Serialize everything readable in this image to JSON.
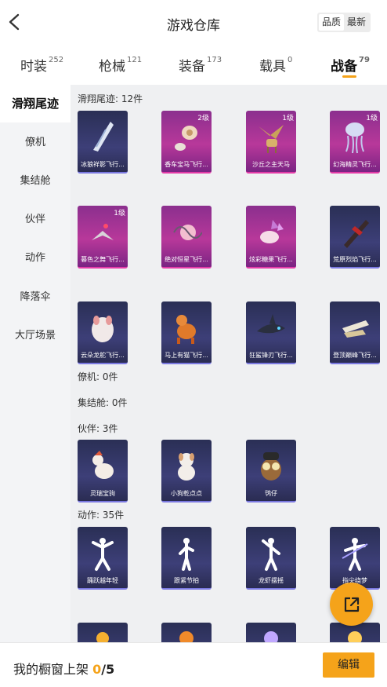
{
  "header": {
    "title": "游戏仓库",
    "sort_options": [
      "品质",
      "最新"
    ],
    "sort_selected": "品质"
  },
  "tabs": [
    {
      "label": "时装",
      "count": "252"
    },
    {
      "label": "枪械",
      "count": "121"
    },
    {
      "label": "装备",
      "count": "173"
    },
    {
      "label": "载具",
      "count": "0"
    },
    {
      "label": "战备",
      "count": "79",
      "active": true
    }
  ],
  "colors": {
    "accent": "#f5a31a",
    "rare_card": "#b8389a",
    "epic_card": "#3d3f78"
  },
  "sidebar": {
    "items": [
      "滑翔尾迹",
      "僚机",
      "集结舱",
      "伙伴",
      "动作",
      "降落伞",
      "大厅场景"
    ],
    "active": "滑翔尾迹"
  },
  "sections": {
    "glide_title": "滑翔尾迹: 12件",
    "glide_items": [
      {
        "name": "冰狼祥影飞行...",
        "level": "",
        "icon": "ice-wing-icon"
      },
      {
        "name": "香车宝马飞行...",
        "level": "2级",
        "icon": "carriage-icon"
      },
      {
        "name": "沙丘之主天马",
        "level": "1级",
        "icon": "pegasus-icon"
      },
      {
        "name": "幻海精灵飞行...",
        "level": "1级",
        "icon": "jellyfish-icon"
      },
      {
        "name": "暮色之舞飞行...",
        "level": "1级",
        "icon": "dusk-dance-icon"
      },
      {
        "name": "绝对恒星飞行...",
        "level": "",
        "icon": "star-orb-icon"
      },
      {
        "name": "炫彩糖果飞行...",
        "level": "",
        "icon": "candy-icon"
      },
      {
        "name": "荒原烈焰飞行...",
        "level": "",
        "icon": "flame-craft-icon"
      },
      {
        "name": "云朵龙舵飞行...",
        "level": "",
        "icon": "cloud-dragon-icon"
      },
      {
        "name": "马上有猫飞行...",
        "level": "",
        "icon": "horse-cat-icon"
      },
      {
        "name": "狂鲨锋刃飞行...",
        "level": "",
        "icon": "shark-icon"
      },
      {
        "name": "登顶巅峰飞行...",
        "level": "",
        "icon": "peak-jet-icon"
      }
    ],
    "wingman_title": "僚机: 0件",
    "pod_title": "集结舱: 0件",
    "partner_title": "伙伴: 3件",
    "partner_items": [
      {
        "name": "灵瑞宝驹",
        "icon": "pony-icon"
      },
      {
        "name": "小狗乾点点",
        "icon": "puppy-icon"
      },
      {
        "name": "鸮仔",
        "icon": "owl-icon"
      }
    ],
    "action_title": "动作: 35件",
    "action_items": [
      {
        "name": "踊跃越年轻",
        "icon": "dance-pose-icon"
      },
      {
        "name": "跟紧节拍",
        "icon": "beat-pose-icon"
      },
      {
        "name": "龙虾摆摇",
        "icon": "lobster-pose-icon"
      },
      {
        "name": "指尖绕梦",
        "icon": "fingertip-pose-icon"
      },
      {
        "name": "",
        "icon": "spark-pose-icon"
      },
      {
        "name": "",
        "icon": "burst-pose-icon"
      },
      {
        "name": "",
        "icon": "glow-pose-icon"
      },
      {
        "name": "",
        "icon": "flare-pose-icon"
      }
    ]
  },
  "bottom": {
    "label": "我的橱窗上架",
    "count": "0",
    "total": "/5",
    "edit_label": "编辑"
  }
}
